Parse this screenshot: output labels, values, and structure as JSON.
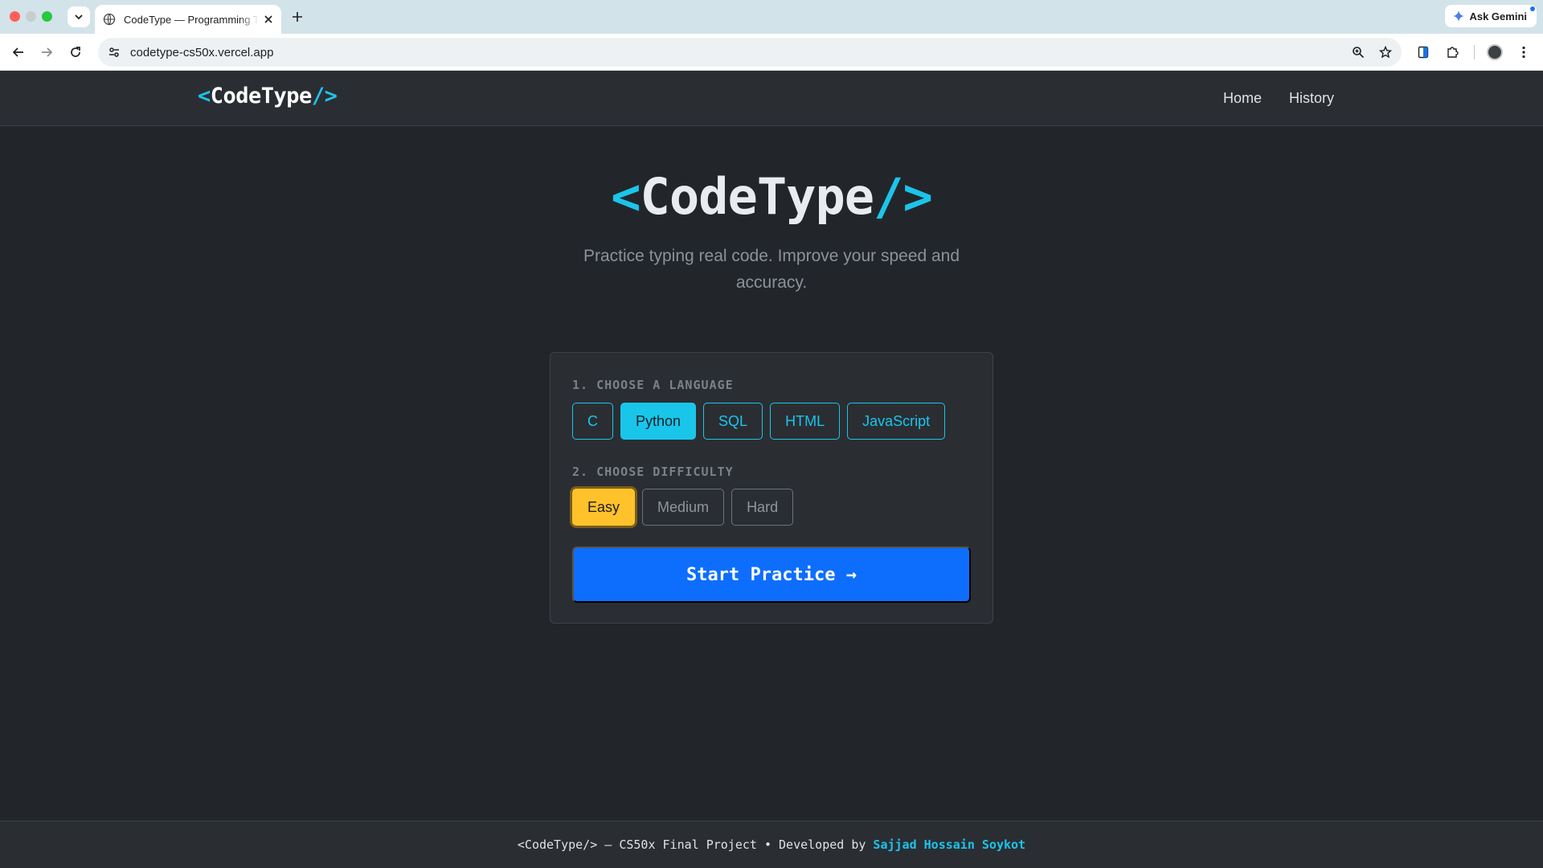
{
  "browser": {
    "tab_title": "CodeType — Programming Typing Practice",
    "url": "codetype-cs50x.vercel.app",
    "gemini_label": "Ask Gemini"
  },
  "header": {
    "logo_open": "<",
    "logo_text": "CodeType",
    "logo_close": "/>",
    "nav": {
      "home": "Home",
      "history": "History"
    }
  },
  "hero": {
    "title_open": "<",
    "title_text": "CodeType",
    "title_close": "/>",
    "subtitle": "Practice typing real code. Improve your speed and accuracy."
  },
  "card": {
    "language_label": "1. CHOOSE A LANGUAGE",
    "languages": [
      "C",
      "Python",
      "SQL",
      "HTML",
      "JavaScript"
    ],
    "selected_language": "Python",
    "difficulty_label": "2. CHOOSE DIFFICULTY",
    "difficulties": [
      "Easy",
      "Medium",
      "Hard"
    ],
    "selected_difficulty": "Easy",
    "start_label": "Start Practice →"
  },
  "footer": {
    "text": "<CodeType/> — CS50x Final Project • Developed by",
    "author": "Sajjad Hossain Soykot"
  },
  "colors": {
    "accent": "#1cc4ea",
    "primary": "#0d6efd",
    "selected_difficulty": "#ffc22a",
    "background": "#22262b"
  }
}
